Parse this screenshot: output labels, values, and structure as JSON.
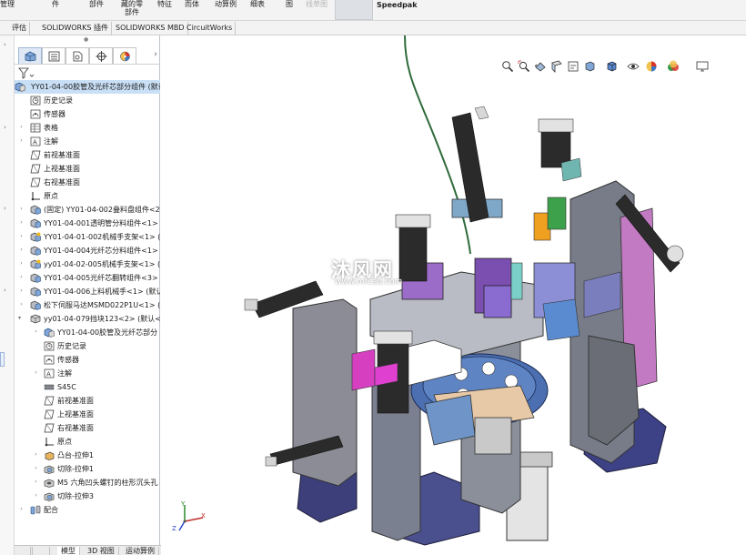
{
  "ribbon": {
    "items": [
      {
        "label": "管理",
        "sub": ""
      },
      {
        "label": "件",
        "sub": ""
      },
      {
        "label": "部件",
        "sub": ""
      },
      {
        "label": "藏的零",
        "sub": "部件"
      },
      {
        "label": "特征",
        "sub": ""
      },
      {
        "label": "而体",
        "sub": ""
      },
      {
        "label": "动算例",
        "sub": ""
      },
      {
        "label": "细表",
        "sub": ""
      },
      {
        "label": "图",
        "sub": ""
      },
      {
        "label": "线草图",
        "sub": ""
      }
    ],
    "speedpak": "Speedpak"
  },
  "tabs": [
    "评估",
    "SOLIDWORKS 插件",
    "SOLIDWORKS MBD",
    "CircuitWorks"
  ],
  "feature_tree": {
    "root": "YY01-04-00胶管及光纤芯部分组件 (默认",
    "items": [
      {
        "label": "历史记录"
      },
      {
        "label": "传感器"
      },
      {
        "label": "表格"
      },
      {
        "label": "注解"
      },
      {
        "label": "前视基准面"
      },
      {
        "label": "上视基准面"
      },
      {
        "label": "右视基准面"
      },
      {
        "label": "原点"
      },
      {
        "label": "(固定) YY01-04-002叠料盘组件<2"
      },
      {
        "label": "YY01-04-001透明管分料组件<1>"
      },
      {
        "label": "YY01-04-01-002机械手支架<1> ("
      },
      {
        "label": "YY01-04-004光纤芯分料组件<1>"
      },
      {
        "label": "yy01-04-02-005机械手支架<1> ("
      },
      {
        "label": "YY01-04-005光纤芯翻转组件<3>"
      },
      {
        "label": "YY01-04-006上料机械手<1> (默认"
      },
      {
        "label": "松下伺服马达MSMD022P1U<1> ("
      },
      {
        "label": "yy01-04-079挡块123<2> (默认<<"
      },
      {
        "label": "YY01-04-00胶管及光纤芯部分"
      },
      {
        "label": "历史记录"
      },
      {
        "label": "传感器"
      },
      {
        "label": "注解"
      },
      {
        "label": "S45C"
      },
      {
        "label": "前视基准面"
      },
      {
        "label": "上视基准面"
      },
      {
        "label": "右视基准面"
      },
      {
        "label": "原点"
      },
      {
        "label": "凸台-拉伸1"
      },
      {
        "label": "切除-拉伸1"
      },
      {
        "label": "M5 六角凹头螺钉的柱形沉头孔"
      },
      {
        "label": "切除-拉伸3"
      },
      {
        "label": "配合"
      }
    ]
  },
  "bottom_tabs": [
    "模型",
    "3D 视图",
    "运动算例"
  ],
  "watermark": {
    "main": "沐风网",
    "sub": "www.mfcad.com"
  },
  "triad": {
    "x": "X",
    "y": "Y",
    "z": "Z"
  }
}
